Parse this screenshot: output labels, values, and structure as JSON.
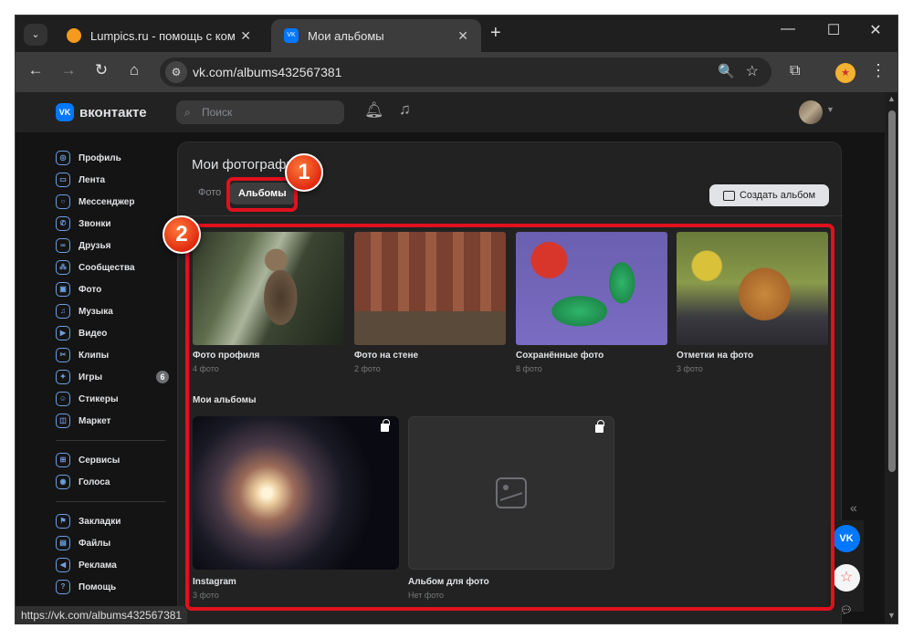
{
  "browser": {
    "tabs": [
      {
        "title": "Lumpics.ru - помощь с компью",
        "close": "✕"
      },
      {
        "title": "Мои альбомы",
        "close": "✕"
      }
    ],
    "tab_dropdown": "⌄",
    "new_tab": "+",
    "window_controls": {
      "minimize": "—",
      "maximize": "☐",
      "close": "✕"
    },
    "nav": {
      "back": "←",
      "forward": "→",
      "reload": "↻",
      "home": "⌂"
    },
    "url": "vk.com/albums432567381",
    "site_info_icon": "⚙",
    "zoom_icon": "🔍",
    "bookmark_icon": "☆",
    "extensions_icon": "⧉",
    "menu_icon": "⋮",
    "status_url": "https://vk.com/albums432567381"
  },
  "vk": {
    "logo_text": "вконтакте",
    "logo_mark": "VK",
    "search_placeholder": "Поиск",
    "sidebar": {
      "items": [
        {
          "label": "Профиль",
          "icon": "◎"
        },
        {
          "label": "Лента",
          "icon": "▭"
        },
        {
          "label": "Мессенджер",
          "icon": "○"
        },
        {
          "label": "Звонки",
          "icon": "✆"
        },
        {
          "label": "Друзья",
          "icon": "∞"
        },
        {
          "label": "Сообщества",
          "icon": "⁂"
        },
        {
          "label": "Фото",
          "icon": "▣"
        },
        {
          "label": "Музыка",
          "icon": "♫"
        },
        {
          "label": "Видео",
          "icon": "▶"
        },
        {
          "label": "Клипы",
          "icon": "✂"
        },
        {
          "label": "Игры",
          "icon": "✦",
          "badge": "6"
        },
        {
          "label": "Стикеры",
          "icon": "☺"
        },
        {
          "label": "Маркет",
          "icon": "◫"
        }
      ],
      "items2": [
        {
          "label": "Сервисы",
          "icon": "⊞"
        },
        {
          "label": "Голоса",
          "icon": "◉"
        }
      ],
      "items3": [
        {
          "label": "Закладки",
          "icon": "⚑"
        },
        {
          "label": "Файлы",
          "icon": "▤"
        },
        {
          "label": "Реклама",
          "icon": "◀"
        },
        {
          "label": "Помощь",
          "icon": "?"
        }
      ]
    },
    "card": {
      "title": "Мои фотографии",
      "tab_photos": "Фото",
      "tab_albums": "Альбомы",
      "create_album": "Создать альбом",
      "system_albums": [
        {
          "name": "Фото профиля",
          "count": "4 фото"
        },
        {
          "name": "Фото на стене",
          "count": "2 фото"
        },
        {
          "name": "Сохранённые фото",
          "count": "8 фото"
        },
        {
          "name": "Отметки на фото",
          "count": "3 фото"
        }
      ],
      "my_albums_label": "Мои альбомы",
      "user_albums": [
        {
          "name": "Instagram",
          "count": "3 фото"
        },
        {
          "name": "Альбом для фото",
          "count": "Нет фото"
        }
      ]
    },
    "markers": [
      "1",
      "2"
    ]
  }
}
